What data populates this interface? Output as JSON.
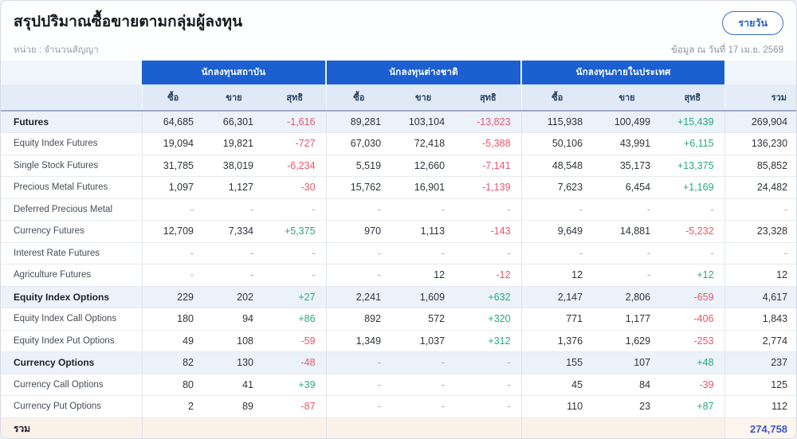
{
  "page": {
    "title": "สรุปปริมาณซื้อขายตามกลุ่มผู้ลงทุน",
    "unit_label": "หน่วย : จำนวนสัญญา",
    "data_date": "ข้อมูล ณ วันที่ 17 เม.ย. 2569",
    "daily_button_label": "รายวัน"
  },
  "colors": {
    "header_blue": "#1b5fd0",
    "positive_green": "#27a97c",
    "negative_red": "#ec5468",
    "grand_total_blue": "#4254c5",
    "total_row_bg": "#faf2e9"
  },
  "table": {
    "groups": [
      {
        "label": "นักลงทุนสถาบัน"
      },
      {
        "label": "นักลงทุนต่างชาติ"
      },
      {
        "label": "นักลงทุนภายในประเทศ"
      }
    ],
    "sub_headers": [
      "ซื้อ",
      "ขาย",
      "สุทธิ"
    ],
    "total_header": "รวม",
    "rows": [
      {
        "label": "Futures",
        "emphasis": true,
        "values": [
          "64,685",
          "66,301",
          "-1,616",
          "89,281",
          "103,104",
          "-13,823",
          "115,938",
          "100,499",
          "+15,439"
        ],
        "total": "269,904"
      },
      {
        "label": "Equity Index Futures",
        "emphasis": false,
        "values": [
          "19,094",
          "19,821",
          "-727",
          "67,030",
          "72,418",
          "-5,388",
          "50,106",
          "43,991",
          "+6,115"
        ],
        "total": "136,230"
      },
      {
        "label": "Single Stock Futures",
        "emphasis": false,
        "values": [
          "31,785",
          "38,019",
          "-6,234",
          "5,519",
          "12,660",
          "-7,141",
          "48,548",
          "35,173",
          "+13,375"
        ],
        "total": "85,852"
      },
      {
        "label": "Precious Metal Futures",
        "emphasis": false,
        "values": [
          "1,097",
          "1,127",
          "-30",
          "15,762",
          "16,901",
          "-1,139",
          "7,623",
          "6,454",
          "+1,169"
        ],
        "total": "24,482"
      },
      {
        "label": "Deferred Precious Metal",
        "emphasis": false,
        "values": [
          "-",
          "-",
          "-",
          "-",
          "-",
          "-",
          "-",
          "-",
          "-"
        ],
        "total": "-"
      },
      {
        "label": "Currency Futures",
        "emphasis": false,
        "values": [
          "12,709",
          "7,334",
          "+5,375",
          "970",
          "1,113",
          "-143",
          "9,649",
          "14,881",
          "-5,232"
        ],
        "total": "23,328"
      },
      {
        "label": "Interest Rate Futures",
        "emphasis": false,
        "values": [
          "-",
          "-",
          "-",
          "-",
          "-",
          "-",
          "-",
          "-",
          "-"
        ],
        "total": "-"
      },
      {
        "label": "Agriculture Futures",
        "emphasis": false,
        "values": [
          "-",
          "-",
          "-",
          "-",
          "12",
          "-12",
          "12",
          "-",
          "+12"
        ],
        "total": "12"
      },
      {
        "label": "Equity Index Options",
        "emphasis": true,
        "values": [
          "229",
          "202",
          "+27",
          "2,241",
          "1,609",
          "+632",
          "2,147",
          "2,806",
          "-659"
        ],
        "total": "4,617"
      },
      {
        "label": "Equity Index Call Options",
        "emphasis": false,
        "values": [
          "180",
          "94",
          "+86",
          "892",
          "572",
          "+320",
          "771",
          "1,177",
          "-406"
        ],
        "total": "1,843"
      },
      {
        "label": "Equity Index Put Options",
        "emphasis": false,
        "values": [
          "49",
          "108",
          "-59",
          "1,349",
          "1,037",
          "+312",
          "1,376",
          "1,629",
          "-253"
        ],
        "total": "2,774"
      },
      {
        "label": "Currency Options",
        "emphasis": true,
        "values": [
          "82",
          "130",
          "-48",
          "-",
          "-",
          "-",
          "155",
          "107",
          "+48"
        ],
        "total": "237"
      },
      {
        "label": "Currency Call Options",
        "emphasis": false,
        "values": [
          "80",
          "41",
          "+39",
          "-",
          "-",
          "-",
          "45",
          "84",
          "-39"
        ],
        "total": "125"
      },
      {
        "label": "Currency Put Options",
        "emphasis": false,
        "values": [
          "2",
          "89",
          "-87",
          "-",
          "-",
          "-",
          "110",
          "23",
          "+87"
        ],
        "total": "112"
      }
    ],
    "total_row": {
      "label": "รวม",
      "grand_total": "274,758"
    }
  }
}
